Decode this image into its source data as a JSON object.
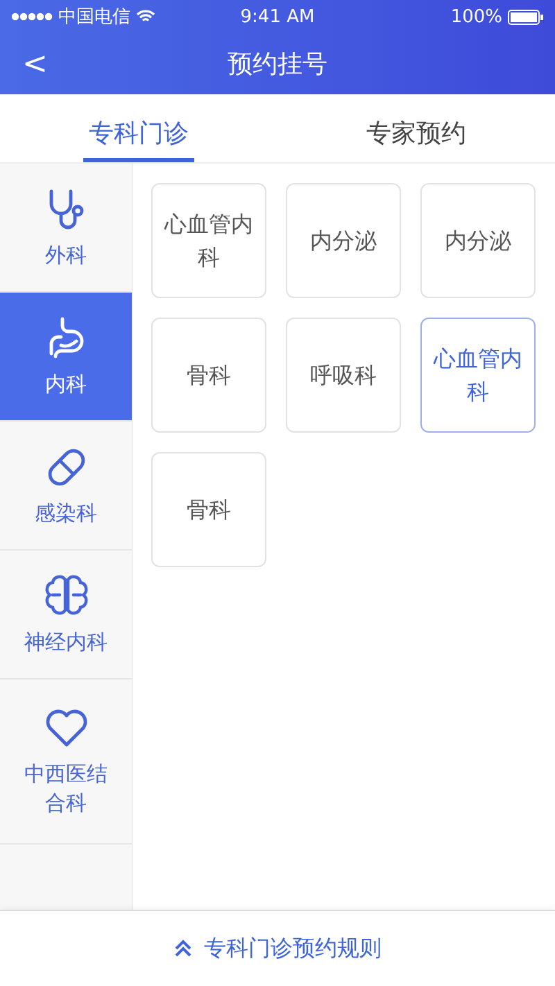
{
  "status_bar": {
    "carrier": "中国电信",
    "time": "9:41 AM",
    "battery": "100%"
  },
  "nav_bar": {
    "back": "<",
    "title": "预约挂号"
  },
  "tabs": [
    {
      "label": "专科门诊",
      "selected": true
    },
    {
      "label": "专家预约",
      "selected": false
    }
  ],
  "sidebar": {
    "items": [
      {
        "label": "外科",
        "selected": false
      },
      {
        "label": "内科",
        "selected": true
      },
      {
        "label": "感染科",
        "selected": false
      },
      {
        "label": "神经内科",
        "selected": false
      },
      {
        "label": "中西医结合科",
        "selected": false
      }
    ]
  },
  "departments": [
    {
      "label": "心血管内科",
      "selected": false
    },
    {
      "label": "内分泌",
      "selected": false
    },
    {
      "label": "内分泌",
      "selected": false
    },
    {
      "label": "骨科",
      "selected": false
    },
    {
      "label": "呼吸科",
      "selected": false
    },
    {
      "label": "心血管内科",
      "selected": true
    },
    {
      "label": "骨科",
      "selected": false
    }
  ],
  "footer": {
    "link": "专科门诊预约规则"
  }
}
